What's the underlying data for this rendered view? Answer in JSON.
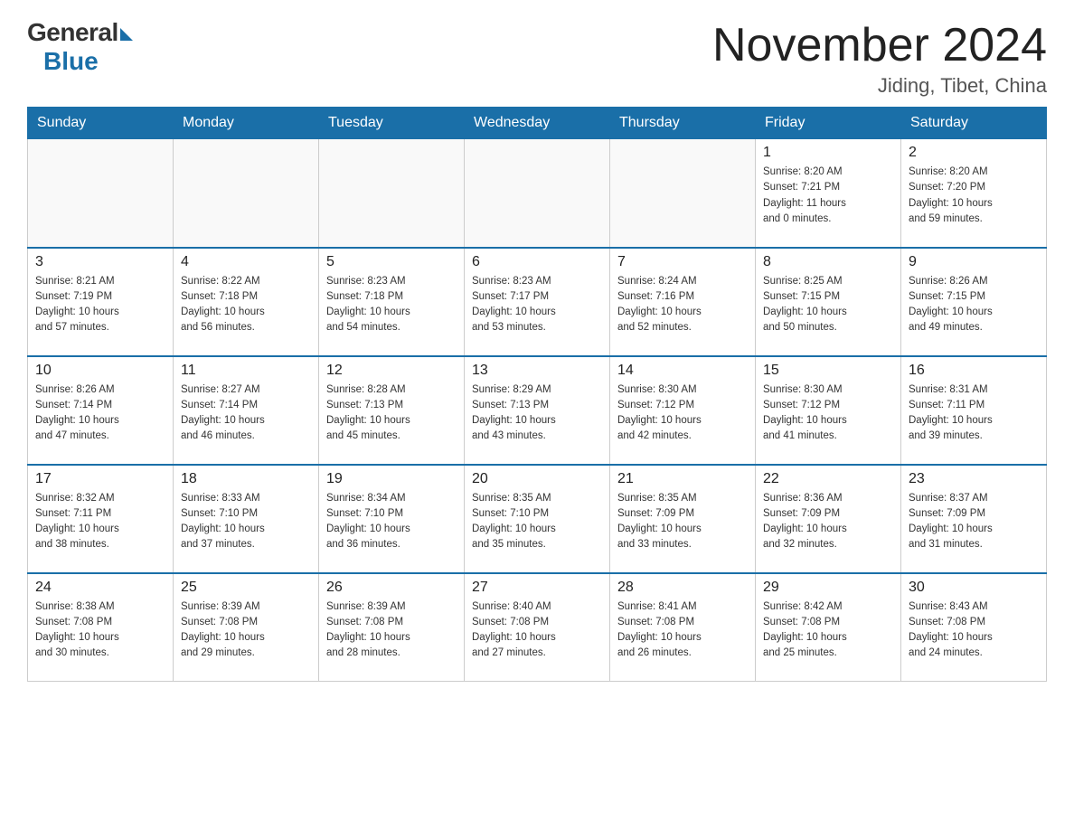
{
  "logo": {
    "general": "General",
    "blue": "Blue"
  },
  "title": "November 2024",
  "location": "Jiding, Tibet, China",
  "days_of_week": [
    "Sunday",
    "Monday",
    "Tuesday",
    "Wednesday",
    "Thursday",
    "Friday",
    "Saturday"
  ],
  "weeks": [
    [
      {
        "day": "",
        "info": ""
      },
      {
        "day": "",
        "info": ""
      },
      {
        "day": "",
        "info": ""
      },
      {
        "day": "",
        "info": ""
      },
      {
        "day": "",
        "info": ""
      },
      {
        "day": "1",
        "info": "Sunrise: 8:20 AM\nSunset: 7:21 PM\nDaylight: 11 hours\nand 0 minutes."
      },
      {
        "day": "2",
        "info": "Sunrise: 8:20 AM\nSunset: 7:20 PM\nDaylight: 10 hours\nand 59 minutes."
      }
    ],
    [
      {
        "day": "3",
        "info": "Sunrise: 8:21 AM\nSunset: 7:19 PM\nDaylight: 10 hours\nand 57 minutes."
      },
      {
        "day": "4",
        "info": "Sunrise: 8:22 AM\nSunset: 7:18 PM\nDaylight: 10 hours\nand 56 minutes."
      },
      {
        "day": "5",
        "info": "Sunrise: 8:23 AM\nSunset: 7:18 PM\nDaylight: 10 hours\nand 54 minutes."
      },
      {
        "day": "6",
        "info": "Sunrise: 8:23 AM\nSunset: 7:17 PM\nDaylight: 10 hours\nand 53 minutes."
      },
      {
        "day": "7",
        "info": "Sunrise: 8:24 AM\nSunset: 7:16 PM\nDaylight: 10 hours\nand 52 minutes."
      },
      {
        "day": "8",
        "info": "Sunrise: 8:25 AM\nSunset: 7:15 PM\nDaylight: 10 hours\nand 50 minutes."
      },
      {
        "day": "9",
        "info": "Sunrise: 8:26 AM\nSunset: 7:15 PM\nDaylight: 10 hours\nand 49 minutes."
      }
    ],
    [
      {
        "day": "10",
        "info": "Sunrise: 8:26 AM\nSunset: 7:14 PM\nDaylight: 10 hours\nand 47 minutes."
      },
      {
        "day": "11",
        "info": "Sunrise: 8:27 AM\nSunset: 7:14 PM\nDaylight: 10 hours\nand 46 minutes."
      },
      {
        "day": "12",
        "info": "Sunrise: 8:28 AM\nSunset: 7:13 PM\nDaylight: 10 hours\nand 45 minutes."
      },
      {
        "day": "13",
        "info": "Sunrise: 8:29 AM\nSunset: 7:13 PM\nDaylight: 10 hours\nand 43 minutes."
      },
      {
        "day": "14",
        "info": "Sunrise: 8:30 AM\nSunset: 7:12 PM\nDaylight: 10 hours\nand 42 minutes."
      },
      {
        "day": "15",
        "info": "Sunrise: 8:30 AM\nSunset: 7:12 PM\nDaylight: 10 hours\nand 41 minutes."
      },
      {
        "day": "16",
        "info": "Sunrise: 8:31 AM\nSunset: 7:11 PM\nDaylight: 10 hours\nand 39 minutes."
      }
    ],
    [
      {
        "day": "17",
        "info": "Sunrise: 8:32 AM\nSunset: 7:11 PM\nDaylight: 10 hours\nand 38 minutes."
      },
      {
        "day": "18",
        "info": "Sunrise: 8:33 AM\nSunset: 7:10 PM\nDaylight: 10 hours\nand 37 minutes."
      },
      {
        "day": "19",
        "info": "Sunrise: 8:34 AM\nSunset: 7:10 PM\nDaylight: 10 hours\nand 36 minutes."
      },
      {
        "day": "20",
        "info": "Sunrise: 8:35 AM\nSunset: 7:10 PM\nDaylight: 10 hours\nand 35 minutes."
      },
      {
        "day": "21",
        "info": "Sunrise: 8:35 AM\nSunset: 7:09 PM\nDaylight: 10 hours\nand 33 minutes."
      },
      {
        "day": "22",
        "info": "Sunrise: 8:36 AM\nSunset: 7:09 PM\nDaylight: 10 hours\nand 32 minutes."
      },
      {
        "day": "23",
        "info": "Sunrise: 8:37 AM\nSunset: 7:09 PM\nDaylight: 10 hours\nand 31 minutes."
      }
    ],
    [
      {
        "day": "24",
        "info": "Sunrise: 8:38 AM\nSunset: 7:08 PM\nDaylight: 10 hours\nand 30 minutes."
      },
      {
        "day": "25",
        "info": "Sunrise: 8:39 AM\nSunset: 7:08 PM\nDaylight: 10 hours\nand 29 minutes."
      },
      {
        "day": "26",
        "info": "Sunrise: 8:39 AM\nSunset: 7:08 PM\nDaylight: 10 hours\nand 28 minutes."
      },
      {
        "day": "27",
        "info": "Sunrise: 8:40 AM\nSunset: 7:08 PM\nDaylight: 10 hours\nand 27 minutes."
      },
      {
        "day": "28",
        "info": "Sunrise: 8:41 AM\nSunset: 7:08 PM\nDaylight: 10 hours\nand 26 minutes."
      },
      {
        "day": "29",
        "info": "Sunrise: 8:42 AM\nSunset: 7:08 PM\nDaylight: 10 hours\nand 25 minutes."
      },
      {
        "day": "30",
        "info": "Sunrise: 8:43 AM\nSunset: 7:08 PM\nDaylight: 10 hours\nand 24 minutes."
      }
    ]
  ]
}
